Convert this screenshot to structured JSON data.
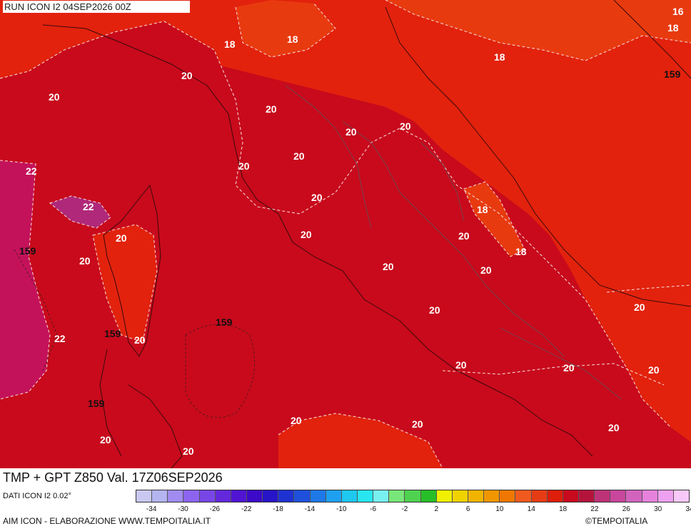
{
  "run_label": "RUN ICON I2 04SEP2026 00Z",
  "title": "TMP + GPT Z850 Val. 17Z06SEP2026",
  "footer": {
    "dati": "DATI ICON I2 0.02°",
    "credit_left": "AIM ICON - ELABORAZIONE WWW.TEMPOITALIA.IT",
    "credit_right": "©TEMPOITALIA"
  },
  "colors": {
    "c16": "#e83a0f",
    "c18": "#e2220d",
    "c20": "#c80a1c",
    "c22": "#c4125a",
    "c22b": "#b0287a"
  },
  "scale": {
    "colors": [
      "#c8c8f0",
      "#b4b4f0",
      "#a08cf0",
      "#8c64f0",
      "#7846e6",
      "#6428dc",
      "#5014d2",
      "#3c0ac8",
      "#2814c8",
      "#1e32d2",
      "#1e50dc",
      "#1e78e6",
      "#1ea0f0",
      "#1ec8f0",
      "#28e6f0",
      "#78f0f0",
      "#78e678",
      "#50d250",
      "#28be28",
      "#f0f000",
      "#f0d200",
      "#f0b400",
      "#f09600",
      "#f07800",
      "#f05a1e",
      "#e63c14",
      "#dc1e0a",
      "#c80a1e",
      "#b4143c",
      "#be3278",
      "#c8469b",
      "#d264be",
      "#e682dc",
      "#f0a0f0",
      "#f8c8f8"
    ],
    "tick_labels": [
      "-34",
      "-30",
      "-26",
      "-22",
      "-18",
      "-14",
      "-10",
      "-6",
      "-2",
      "2",
      "6",
      "10",
      "14",
      "18",
      "22",
      "26",
      "30",
      "34"
    ]
  },
  "temperature_labels": [
    "16",
    "18",
    "18",
    "18",
    "18",
    "18",
    "18",
    "20",
    "20",
    "20",
    "20",
    "20",
    "20",
    "20",
    "20",
    "20",
    "20",
    "20",
    "20",
    "20",
    "20",
    "20",
    "20",
    "20",
    "20",
    "20",
    "20",
    "20",
    "20",
    "20",
    "22",
    "22",
    "22"
  ],
  "gpt_labels": [
    "159",
    "159",
    "159",
    "159",
    "159"
  ]
}
